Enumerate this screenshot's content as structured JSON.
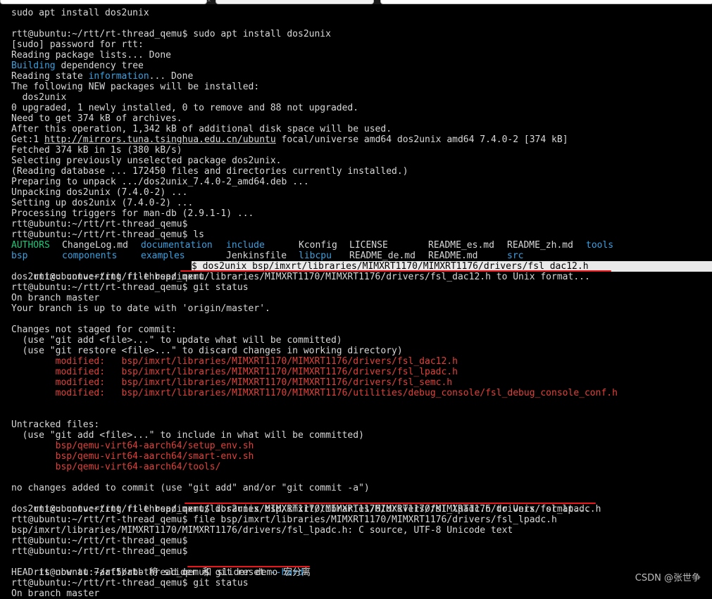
{
  "terminal": {
    "lines": {
      "l0": "sudo apt install dos2unix",
      "l1": "",
      "l2": "rtt@ubuntu:~/rtt/rt-thread_qemu$ sudo apt install dos2unix",
      "l3": "[sudo] password for rtt:",
      "l4": "Reading package lists... Done",
      "l5a": "Building",
      "l5b": " dependency tree",
      "l6a": "Reading state ",
      "l6b": "information",
      "l6c": "... Done",
      "l7": "The following NEW packages will be installed:",
      "l8": "  dos2unix",
      "l9": "0 upgraded, 1 newly installed, 0 to remove and 88 not upgraded.",
      "l10": "Need to get 374 kB of archives.",
      "l11": "After this operation, 1,342 kB of additional disk space will be used.",
      "l12a": "Get:1 ",
      "l12b": "http://mirrors.tuna.tsinghua.edu.cn/ubuntu",
      "l12c": " focal/universe amd64 dos2unix amd64 7.4.0-2 [374 kB]",
      "l13": "Fetched 374 kB in 1s (380 kB/s)",
      "l14": "Selecting previously unselected package dos2unix.",
      "l15": "(Reading database ... 172450 files and directories currently installed.)",
      "l16": "Preparing to unpack .../dos2unix_7.4.0-2_amd64.deb ...",
      "l17": "Unpacking dos2unix (7.4.0-2) ...",
      "l18": "Setting up dos2unix (7.4.0-2) ...",
      "l19": "Processing triggers for man-db (2.9.1-1) ...",
      "l20": "rtt@ubuntu:~/rtt/rt-thread_qemu$",
      "l21": "rtt@ubuntu:~/rtt/rt-thread_qemu$ ls",
      "l24a": "rtt@ubuntu:~/rtt/rt-thread_qemu",
      "l24b": "$ dos2unix bsp/imxrt/libraries/MIMXRT1170/MIMXRT1176/drivers/fsl_dac12.h",
      "l25": "dos2unix: converting file bsp/imxrt/libraries/MIMXRT1170/MIMXRT1176/drivers/fsl_dac12.h to Unix format...",
      "l26": "rtt@ubuntu:~/rtt/rt-thread_qemu$ git status",
      "l27": "On branch master",
      "l28": "Your branch is up to date with 'origin/master'.",
      "l29": "",
      "l30": "Changes not staged for commit:",
      "l31": "  (use \"git add <file>...\" to update what will be committed)",
      "l32": "  (use \"git restore <file>...\" to discard changes in working directory)",
      "l33": "        modified:   bsp/imxrt/libraries/MIMXRT1170/MIMXRT1176/drivers/fsl_dac12.h",
      "l34": "        modified:   bsp/imxrt/libraries/MIMXRT1170/MIMXRT1176/drivers/fsl_lpadc.h",
      "l35": "        modified:   bsp/imxrt/libraries/MIMXRT1170/MIMXRT1176/drivers/fsl_semc.h",
      "l36": "        modified:   bsp/imxrt/libraries/MIMXRT1170/MIMXRT1176/utilities/debug_console/fsl_debug_console_conf.h",
      "l37": "",
      "l38": "",
      "l39": "Untracked files:",
      "l40": "  (use \"git add <file>...\" to include in what will be committed)",
      "l41": "        bsp/qemu-virt64-aarch64/setup_env.sh",
      "l42": "        bsp/qemu-virt64-aarch64/smart-env.sh",
      "l43": "        bsp/qemu-virt64-aarch64/tools/",
      "l44": "",
      "l45": "no changes added to commit (use \"git add\" and/or \"git commit -a\")",
      "l46": "rtt@ubuntu:~/rtt/rt-thread_qemu$ dos2unix bsp/imxrt/libraries/MIMXRT1170/MIMXRT1176/drivers/fsl_lpadc.h",
      "l47": "dos2unix: converting file bsp/imxrt/libraries/MIMXRT1170/MIMXRT1176/drivers/fsl_lpadc.h to Unix format...",
      "l48": "rtt@ubuntu:~/rtt/rt-thread_qemu$ file bsp/imxrt/libraries/MIMXRT1170/MIMXRT1176/drivers/fsl_lpadc.h",
      "l49": "bsp/imxrt/libraries/MIMXRT1170/MIMXRT1176/drivers/fsl_lpadc.h: C source, UTF-8 Unicode text",
      "l50": "rtt@ubuntu:~/rtt/rt-thread_qemu$",
      "l51": "rtt@ubuntu:~/rtt/rt-thread_qemu$",
      "l52a": "rtt@ubuntu:~/rtt/rt-thread_qemu$ git reset ",
      "l52b": "--hard",
      "l53": "HEAD is now at 7aaf5babb 将 slider 和 slider demo 宏分离",
      "l54": "rtt@ubuntu:~/rtt/rt-thread_qemu$ git status",
      "l55": "On branch master"
    },
    "ls_row1": {
      "c1": "AUTHORS",
      "c2": "ChangeLog.md",
      "c3": "documentation",
      "c4": "include",
      "c5": "Kconfig",
      "c6": "LICENSE",
      "c7": "README_es.md",
      "c8": "README_zh.md",
      "c9": "tools"
    },
    "ls_row2": {
      "c1": "bsp",
      "c2": "components",
      "c3": "examples",
      "c4": "Jenkinsfile",
      "c5": "libcpu",
      "c6": "README_de.md",
      "c7": "README.md",
      "c8": "src"
    }
  },
  "watermark": "CSDN @张世争",
  "colors": {
    "blue": "#3aa0e0",
    "green": "#22c77a",
    "red": "#e0403a",
    "underline": "#e8171b"
  }
}
